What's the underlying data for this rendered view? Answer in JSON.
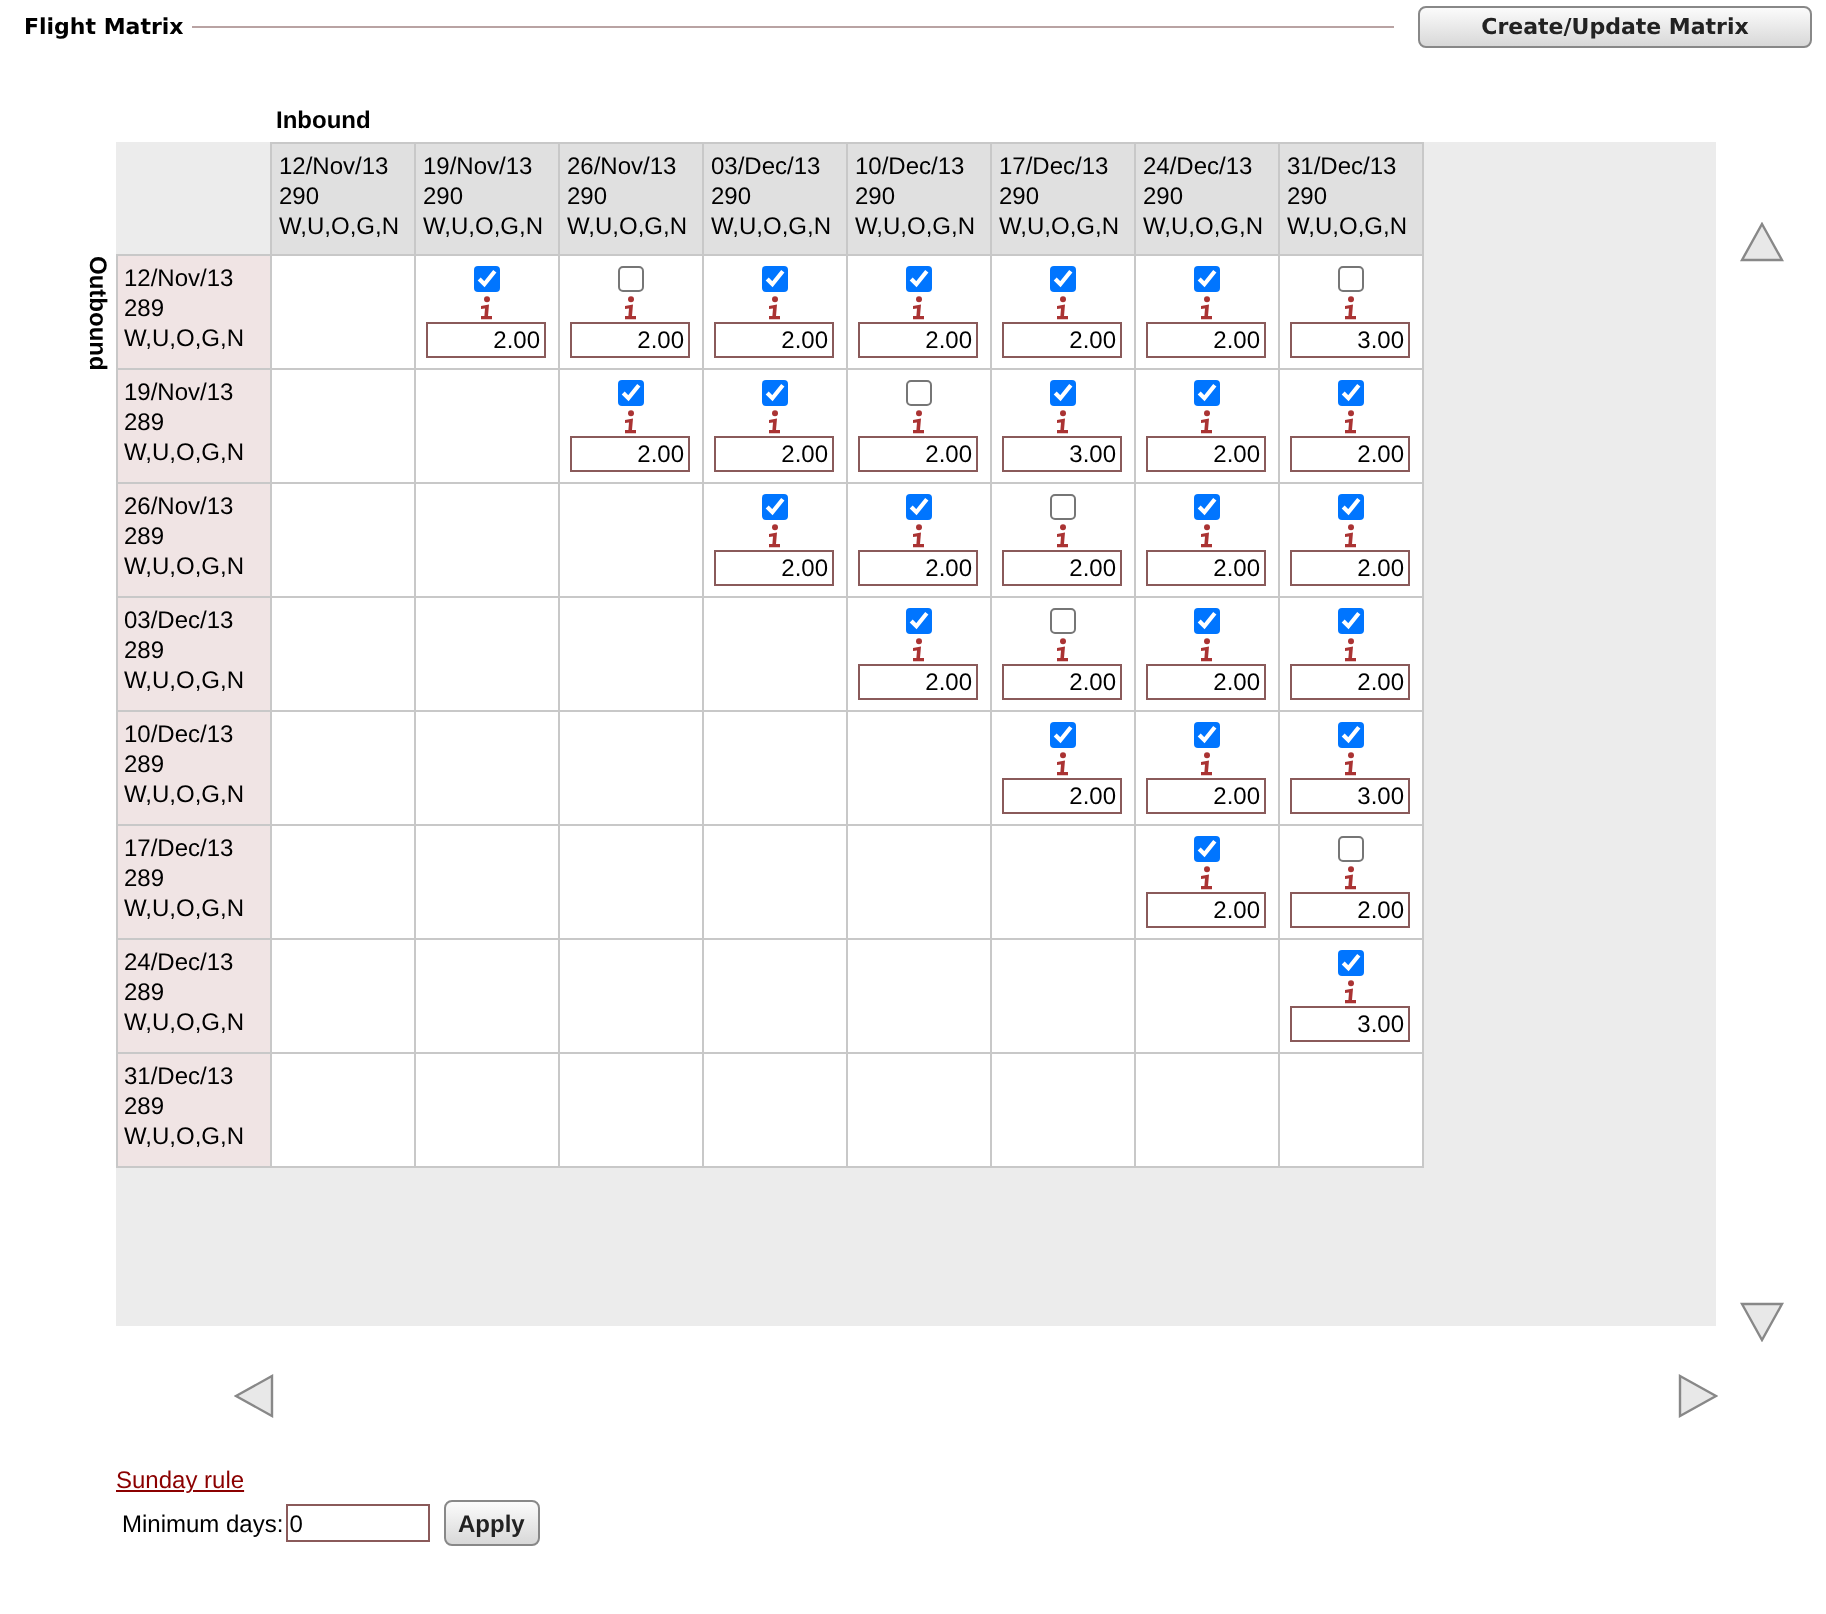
{
  "title": "Flight Matrix",
  "create_button": "Create/Update Matrix",
  "inbound_label": "Inbound",
  "outbound_label": "Outbound",
  "inbound_columns": [
    {
      "date": "12/Nov/13",
      "flight": "290",
      "classes": "W,U,O,G,N"
    },
    {
      "date": "19/Nov/13",
      "flight": "290",
      "classes": "W,U,O,G,N"
    },
    {
      "date": "26/Nov/13",
      "flight": "290",
      "classes": "W,U,O,G,N"
    },
    {
      "date": "03/Dec/13",
      "flight": "290",
      "classes": "W,U,O,G,N"
    },
    {
      "date": "10/Dec/13",
      "flight": "290",
      "classes": "W,U,O,G,N"
    },
    {
      "date": "17/Dec/13",
      "flight": "290",
      "classes": "W,U,O,G,N"
    },
    {
      "date": "24/Dec/13",
      "flight": "290",
      "classes": "W,U,O,G,N"
    },
    {
      "date": "31/Dec/13",
      "flight": "290",
      "classes": "W,U,O,G,N"
    }
  ],
  "outbound_rows": [
    {
      "date": "12/Nov/13",
      "flight": "289",
      "classes": "W,U,O,G,N",
      "cells": [
        {
          "kind": "empty"
        },
        {
          "kind": "option",
          "checked": true,
          "value": "2.00"
        },
        {
          "kind": "option",
          "checked": false,
          "value": "2.00"
        },
        {
          "kind": "option",
          "checked": true,
          "value": "2.00"
        },
        {
          "kind": "option",
          "checked": true,
          "value": "2.00"
        },
        {
          "kind": "option",
          "checked": true,
          "value": "2.00"
        },
        {
          "kind": "option",
          "checked": true,
          "value": "2.00"
        },
        {
          "kind": "option",
          "checked": false,
          "value": "3.00"
        }
      ]
    },
    {
      "date": "19/Nov/13",
      "flight": "289",
      "classes": "W,U,O,G,N",
      "cells": [
        {
          "kind": "empty"
        },
        {
          "kind": "empty"
        },
        {
          "kind": "option",
          "checked": true,
          "value": "2.00"
        },
        {
          "kind": "option",
          "checked": true,
          "value": "2.00"
        },
        {
          "kind": "option",
          "checked": false,
          "value": "2.00"
        },
        {
          "kind": "option",
          "checked": true,
          "value": "3.00"
        },
        {
          "kind": "option",
          "checked": true,
          "value": "2.00"
        },
        {
          "kind": "option",
          "checked": true,
          "value": "2.00"
        }
      ]
    },
    {
      "date": "26/Nov/13",
      "flight": "289",
      "classes": "W,U,O,G,N",
      "cells": [
        {
          "kind": "empty"
        },
        {
          "kind": "empty"
        },
        {
          "kind": "empty"
        },
        {
          "kind": "option",
          "checked": true,
          "value": "2.00"
        },
        {
          "kind": "option",
          "checked": true,
          "value": "2.00"
        },
        {
          "kind": "option",
          "checked": false,
          "value": "2.00"
        },
        {
          "kind": "option",
          "checked": true,
          "value": "2.00"
        },
        {
          "kind": "option",
          "checked": true,
          "value": "2.00"
        }
      ]
    },
    {
      "date": "03/Dec/13",
      "flight": "289",
      "classes": "W,U,O,G,N",
      "cells": [
        {
          "kind": "empty"
        },
        {
          "kind": "empty"
        },
        {
          "kind": "empty"
        },
        {
          "kind": "empty"
        },
        {
          "kind": "option",
          "checked": true,
          "value": "2.00"
        },
        {
          "kind": "option",
          "checked": false,
          "value": "2.00"
        },
        {
          "kind": "option",
          "checked": true,
          "value": "2.00"
        },
        {
          "kind": "option",
          "checked": true,
          "value": "2.00"
        }
      ]
    },
    {
      "date": "10/Dec/13",
      "flight": "289",
      "classes": "W,U,O,G,N",
      "cells": [
        {
          "kind": "empty"
        },
        {
          "kind": "empty"
        },
        {
          "kind": "empty"
        },
        {
          "kind": "empty"
        },
        {
          "kind": "empty"
        },
        {
          "kind": "option",
          "checked": true,
          "value": "2.00"
        },
        {
          "kind": "option",
          "checked": true,
          "value": "2.00"
        },
        {
          "kind": "option",
          "checked": true,
          "value": "3.00"
        }
      ]
    },
    {
      "date": "17/Dec/13",
      "flight": "289",
      "classes": "W,U,O,G,N",
      "cells": [
        {
          "kind": "empty"
        },
        {
          "kind": "empty"
        },
        {
          "kind": "empty"
        },
        {
          "kind": "empty"
        },
        {
          "kind": "empty"
        },
        {
          "kind": "empty"
        },
        {
          "kind": "option",
          "checked": true,
          "value": "2.00"
        },
        {
          "kind": "option",
          "checked": false,
          "value": "2.00"
        }
      ]
    },
    {
      "date": "24/Dec/13",
      "flight": "289",
      "classes": "W,U,O,G,N",
      "cells": [
        {
          "kind": "empty"
        },
        {
          "kind": "empty"
        },
        {
          "kind": "empty"
        },
        {
          "kind": "empty"
        },
        {
          "kind": "empty"
        },
        {
          "kind": "empty"
        },
        {
          "kind": "empty"
        },
        {
          "kind": "option",
          "checked": true,
          "value": "3.00"
        }
      ]
    },
    {
      "date": "31/Dec/13",
      "flight": "289",
      "classes": "W,U,O,G,N",
      "cells": [
        {
          "kind": "empty"
        },
        {
          "kind": "empty"
        },
        {
          "kind": "empty"
        },
        {
          "kind": "empty"
        },
        {
          "kind": "empty"
        },
        {
          "kind": "empty"
        },
        {
          "kind": "empty"
        },
        {
          "kind": "empty"
        }
      ]
    }
  ],
  "sunday_rule_link": "Sunday rule",
  "minimum_days": {
    "label": "Minimum days:",
    "value": "0"
  },
  "apply_button": "Apply"
}
